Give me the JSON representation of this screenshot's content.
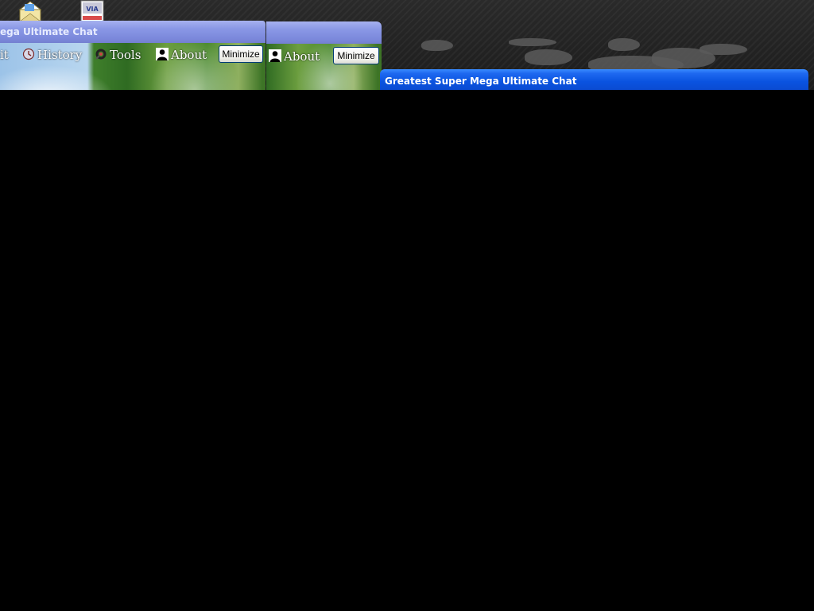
{
  "desktop": {
    "icons": [
      {
        "name": "envelope-icon"
      },
      {
        "name": "via-driver-icon",
        "label": "VIA"
      }
    ]
  },
  "windows": {
    "left": {
      "title": "ega Ultimate Chat",
      "menu": {
        "edit_fragment": "it",
        "history": "History",
        "tools": "Tools",
        "about": "About"
      },
      "minimize": "Minimize"
    },
    "middle": {
      "menu": {
        "about": "About"
      },
      "minimize": "Minimize"
    },
    "right": {
      "title": "Greatest Super Mega Ultimate Chat"
    }
  }
}
